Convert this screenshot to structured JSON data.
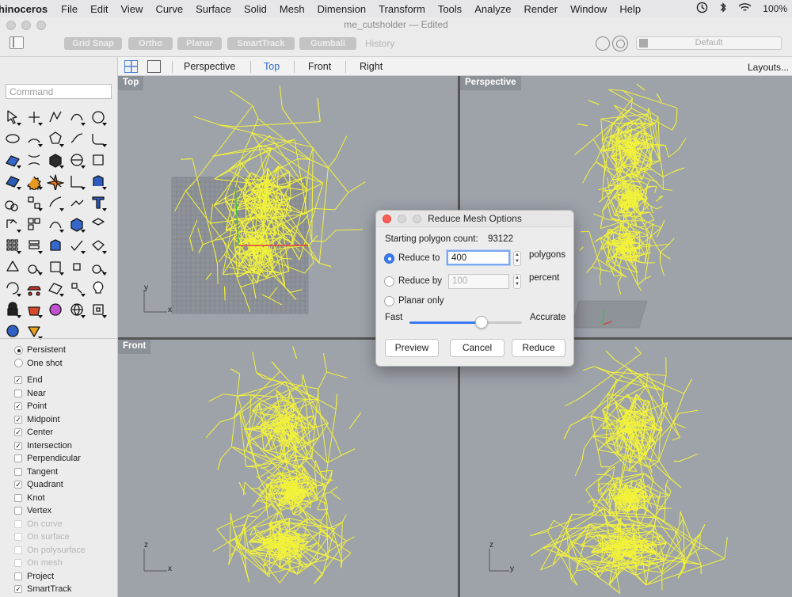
{
  "menubar": {
    "app_name": "hinoceros",
    "menus": [
      "File",
      "Edit",
      "View",
      "Curve",
      "Surface",
      "Solid",
      "Mesh",
      "Dimension",
      "Transform",
      "Tools",
      "Analyze",
      "Render",
      "Window",
      "Help"
    ],
    "battery": "100%",
    "status_icons": [
      "clock-icon",
      "bluetooth-icon",
      "wifi-icon",
      "battery-icon"
    ]
  },
  "window": {
    "title": "me_cutsholder — Edited",
    "toolbar_toggles": [
      "Grid Snap",
      "Ortho",
      "Planar",
      "SmartTrack",
      "Gumball"
    ],
    "history_label": "History",
    "layer": "Default"
  },
  "command": {
    "placeholder": "Command"
  },
  "tools": [
    {
      "name": "select-icon"
    },
    {
      "name": "point-icon"
    },
    {
      "name": "polyline-icon"
    },
    {
      "name": "curve-icon"
    },
    {
      "name": "circle-icon"
    },
    {
      "name": "ellipse-icon"
    },
    {
      "name": "arc-icon"
    },
    {
      "name": "polygon-icon"
    },
    {
      "name": "freeform-icon"
    },
    {
      "name": "fillet-icon"
    },
    {
      "name": "surface-icon"
    },
    {
      "name": "loft-icon"
    },
    {
      "name": "box-icon"
    },
    {
      "name": "sphere-icon"
    },
    {
      "name": "cylinder-icon"
    },
    {
      "name": "mesh-surface-icon"
    },
    {
      "name": "gear-icon"
    },
    {
      "name": "explode-icon"
    },
    {
      "name": "trim-icon"
    },
    {
      "name": "extrude-icon"
    },
    {
      "name": "boolean-icon"
    },
    {
      "name": "group-icon"
    },
    {
      "name": "rebuild-icon"
    },
    {
      "name": "join-icon"
    },
    {
      "name": "text-icon"
    },
    {
      "name": "move-icon"
    },
    {
      "name": "align-icon"
    },
    {
      "name": "curve-edit-icon"
    },
    {
      "name": "solid-edit-icon"
    },
    {
      "name": "analyze-icon"
    },
    {
      "name": "array-icon"
    },
    {
      "name": "layer-icon"
    },
    {
      "name": "extrude-curve-icon"
    },
    {
      "name": "check-icon"
    },
    {
      "name": "unroll-icon"
    },
    {
      "name": "dimension-icon"
    },
    {
      "name": "zoom-icon"
    },
    {
      "name": "zoom-window-icon"
    },
    {
      "name": "zoom-extents-icon"
    },
    {
      "name": "zoom-out-icon"
    },
    {
      "name": "rotate-view-icon"
    },
    {
      "name": "car-icon"
    },
    {
      "name": "render-grid-icon"
    },
    {
      "name": "shapes-icon"
    },
    {
      "name": "light-icon"
    },
    {
      "name": "lock-icon"
    },
    {
      "name": "material-icon"
    },
    {
      "name": "color-wheel-icon"
    },
    {
      "name": "globe-icon"
    },
    {
      "name": "properties-icon"
    },
    {
      "name": "sphere-blue-icon"
    },
    {
      "name": "pointer-drop-icon"
    }
  ],
  "osnaps": {
    "mode": [
      {
        "label": "Persistent",
        "selected": true
      },
      {
        "label": "One shot",
        "selected": false
      }
    ],
    "items": [
      {
        "label": "End",
        "checked": true,
        "enabled": true
      },
      {
        "label": "Near",
        "checked": false,
        "enabled": true
      },
      {
        "label": "Point",
        "checked": true,
        "enabled": true
      },
      {
        "label": "Midpoint",
        "checked": true,
        "enabled": true
      },
      {
        "label": "Center",
        "checked": true,
        "enabled": true
      },
      {
        "label": "Intersection",
        "checked": true,
        "enabled": true
      },
      {
        "label": "Perpendicular",
        "checked": false,
        "enabled": true
      },
      {
        "label": "Tangent",
        "checked": false,
        "enabled": true
      },
      {
        "label": "Quadrant",
        "checked": true,
        "enabled": true
      },
      {
        "label": "Knot",
        "checked": false,
        "enabled": true
      },
      {
        "label": "Vertex",
        "checked": false,
        "enabled": true
      },
      {
        "label": "On curve",
        "checked": false,
        "enabled": false
      },
      {
        "label": "On surface",
        "checked": false,
        "enabled": false
      },
      {
        "label": "On polysurface",
        "checked": false,
        "enabled": false
      },
      {
        "label": "On mesh",
        "checked": false,
        "enabled": false
      },
      {
        "label": "Project",
        "checked": false,
        "enabled": true
      },
      {
        "label": "SmartTrack",
        "checked": true,
        "enabled": true
      }
    ]
  },
  "viewport_tabs": {
    "tabs": [
      "Perspective",
      "Top",
      "Front",
      "Right"
    ],
    "active": "Top",
    "layouts_label": "Layouts..."
  },
  "viewports": {
    "top": {
      "label": "Top",
      "axis_x": "x",
      "axis_y": "y"
    },
    "perspective": {
      "label": "Perspective"
    },
    "front": {
      "label": "Front",
      "axis_x": "x",
      "axis_z": "z"
    },
    "right": {
      "axis_y": "y",
      "axis_z": "z"
    }
  },
  "wire_color": "#f2f23a",
  "dialog": {
    "title": "Reduce Mesh Options",
    "starting_label": "Starting polygon count:",
    "starting_count": "93122",
    "reduce_to_label": "Reduce to",
    "reduce_to_value": "400",
    "reduce_to_unit": "polygons",
    "reduce_by_label": "Reduce by",
    "reduce_by_placeholder": "100",
    "reduce_by_unit": "percent",
    "planar_only_label": "Planar only",
    "fast_label": "Fast",
    "accurate_label": "Accurate",
    "slider_fraction": 0.64,
    "preview_label": "Preview",
    "cancel_label": "Cancel",
    "reduce_label": "Reduce",
    "selected_option": "reduce_to"
  }
}
